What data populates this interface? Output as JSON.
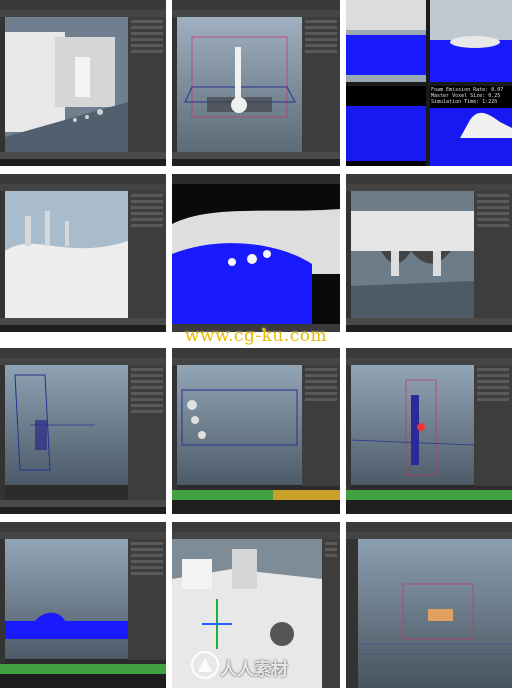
{
  "watermark": {
    "url": "www.cg-ku.com",
    "logo_text": "人人素材"
  },
  "render_info": {
    "lines": [
      "Foam Emission Rate: 0.07",
      "Master Voxel Size: 0.25",
      "Simulation Time: 1:22h"
    ]
  },
  "colors": {
    "shelf_icon": "#6fb6d9",
    "timeline_green": "#41a040",
    "timeline_yellow": "#c8a02a",
    "particles_blue": "#1a1aff",
    "watermark_gold": "#e6b800"
  }
}
